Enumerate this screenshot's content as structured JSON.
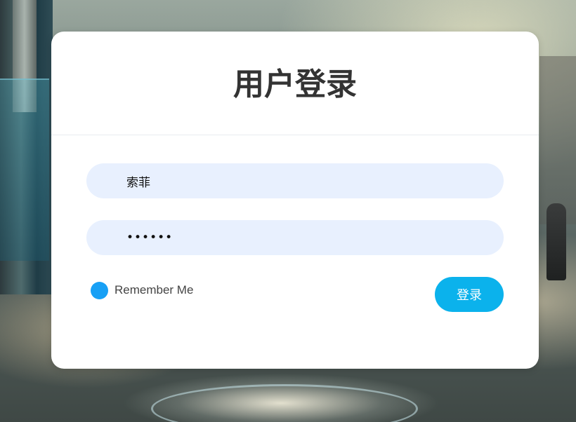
{
  "login": {
    "title": "用户登录",
    "username_value": "索菲",
    "password_value": "••••••",
    "remember_label": "Remember Me",
    "submit_label": "登录"
  },
  "colors": {
    "primary_button": "#0bb2ec",
    "checkbox": "#18a0f5",
    "input_bg": "#e8f0fe",
    "title_text": "#333333"
  }
}
